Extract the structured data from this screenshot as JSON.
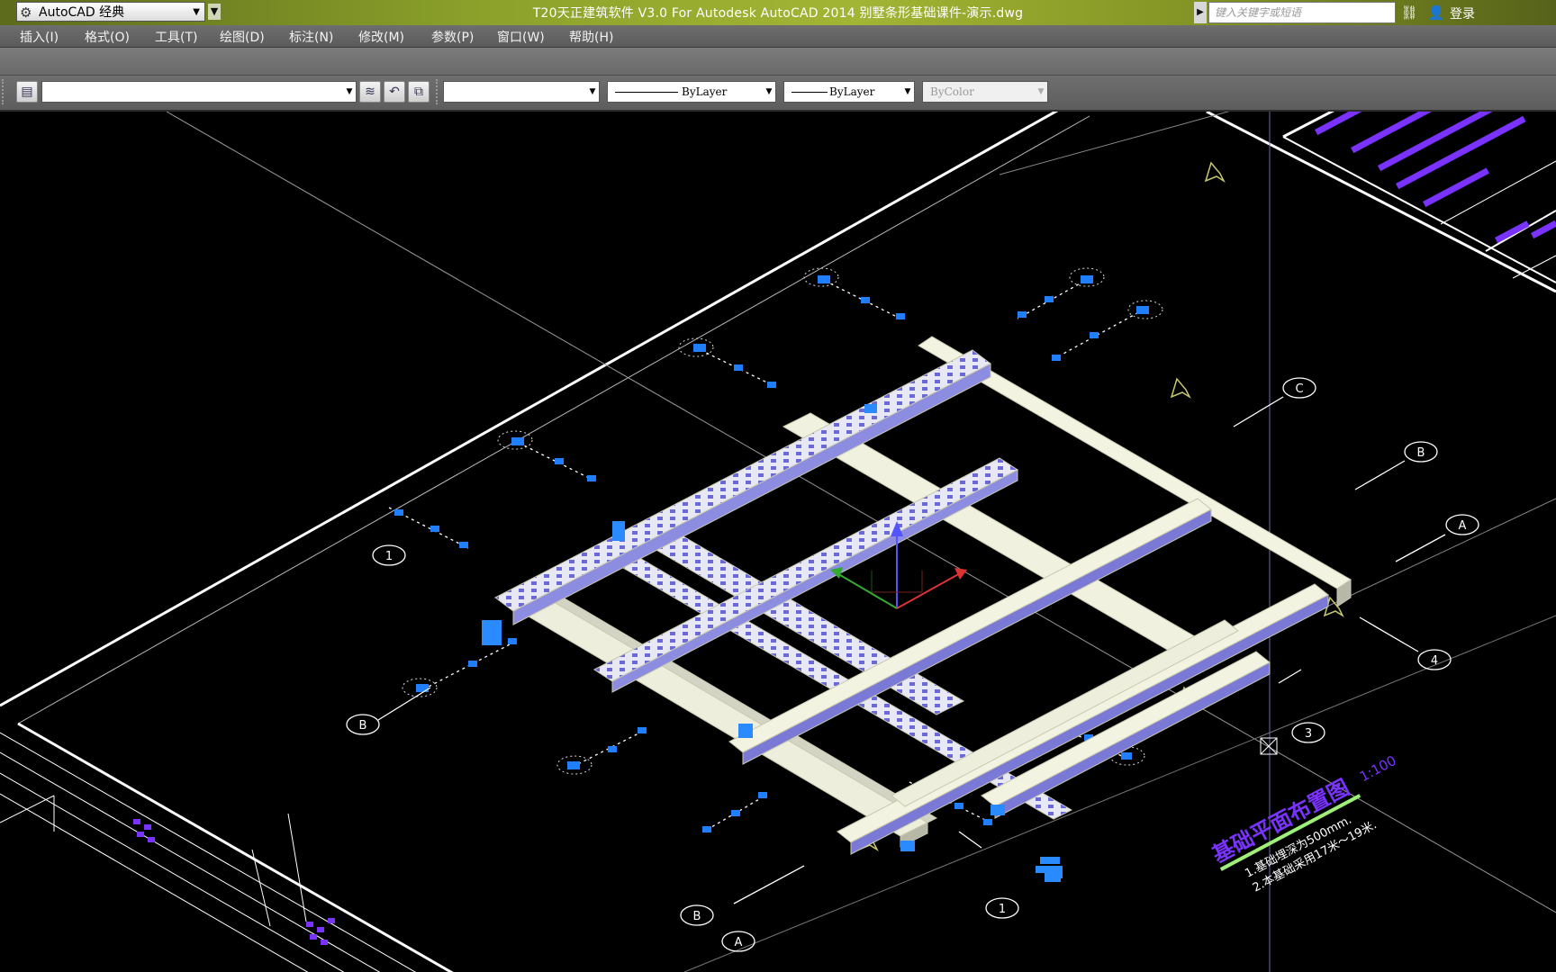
{
  "titlebar": {
    "workspace": "AutoCAD 经典",
    "title": "T20天正建筑软件 V3.0 For Autodesk AutoCAD 2014     别墅条形基础课件-演示.dwg",
    "search_placeholder": "键入关键字或短语",
    "login": "登录"
  },
  "menu": [
    "插入(I)",
    "格式(O)",
    "工具(T)",
    "绘图(D)",
    "标注(N)",
    "修改(M)",
    "参数(P)",
    "窗口(W)",
    "帮助(H)"
  ],
  "properties": {
    "layer_value": "",
    "color_value": "",
    "linetype": "ByLayer",
    "lineweight": "ByLayer",
    "plotstyle": "ByColor"
  },
  "drawing": {
    "axis_labels": [
      "C",
      "B",
      "A",
      "4",
      "3",
      "1",
      "B",
      "B",
      "A",
      "1"
    ],
    "plan_title": "基础平面布置图",
    "plan_scale": "1:100",
    "note_1": "1.基础埋深为500mm.",
    "note_2": "2.本基础采用17米～19米.",
    "colors": {
      "beam": "#f5f5e6",
      "beam_shade": "#6d6dd8",
      "axis_blue": "#1f7fff",
      "frame": "#ffffff",
      "ucs_x": "#d33",
      "ucs_y": "#3a3",
      "ucs_z": "#55f",
      "magenta": "#7a33ff",
      "yellow": "#c8c870"
    }
  }
}
